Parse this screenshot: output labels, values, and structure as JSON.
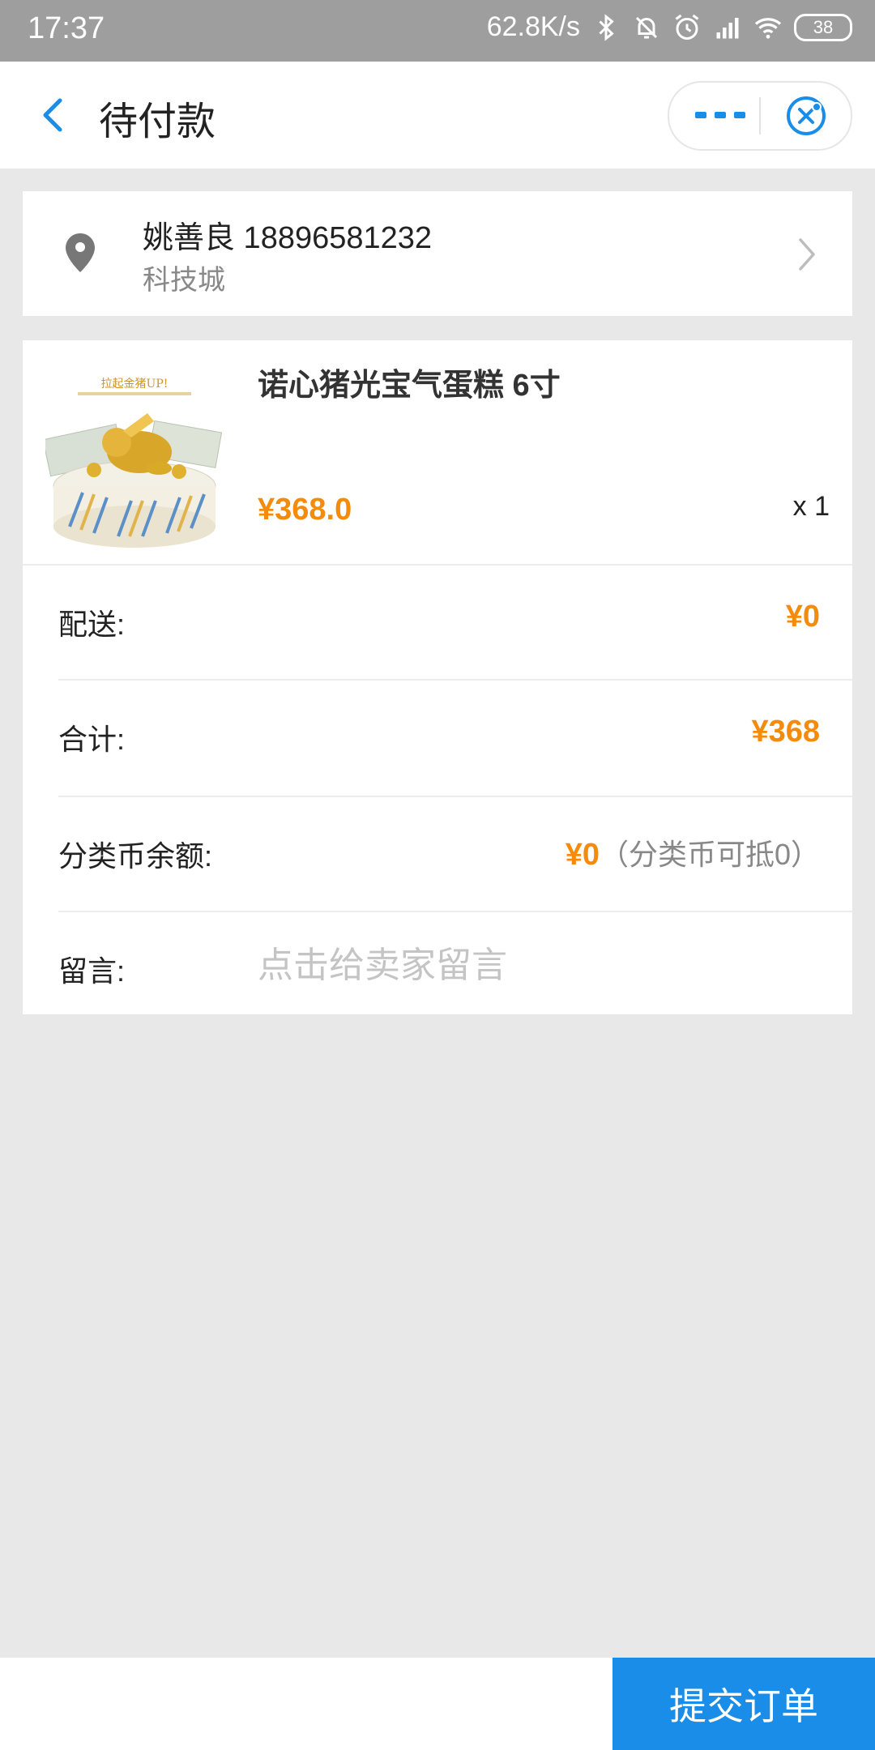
{
  "statusbar": {
    "time": "17:37",
    "speed": "62.8K/s",
    "battery": "38",
    "icons": [
      "bluetooth-icon",
      "bell-muted-icon",
      "alarm-icon",
      "signal-icon",
      "wifi-icon",
      "battery-icon"
    ]
  },
  "header": {
    "title": "待付款",
    "back_icon": "chevron-left-icon",
    "more_icon": "more-dots-icon",
    "close_icon": "miniprogram-close-icon"
  },
  "address": {
    "name_phone": "姚善良 18896581232",
    "area": "科技城",
    "icon": "location-pin-icon"
  },
  "product": {
    "name": "诺心猪光宝气蛋糕 6寸",
    "price": "¥368.0",
    "quantity": "x 1",
    "image_caption": "拉起金猪UP!"
  },
  "rows": {
    "delivery": {
      "label": "配送:",
      "value": "¥0"
    },
    "total": {
      "label": "合计:",
      "value": "¥368"
    },
    "coin": {
      "label": "分类币余额:",
      "value": "¥0",
      "note": "（分类币可抵0）"
    },
    "message": {
      "label": "留言:",
      "placeholder": "点击给卖家留言"
    }
  },
  "footer": {
    "submit_label": "提交订单"
  },
  "colors": {
    "accent": "#1a8de8",
    "price": "#f58b0a",
    "background": "#e8e8e8"
  }
}
